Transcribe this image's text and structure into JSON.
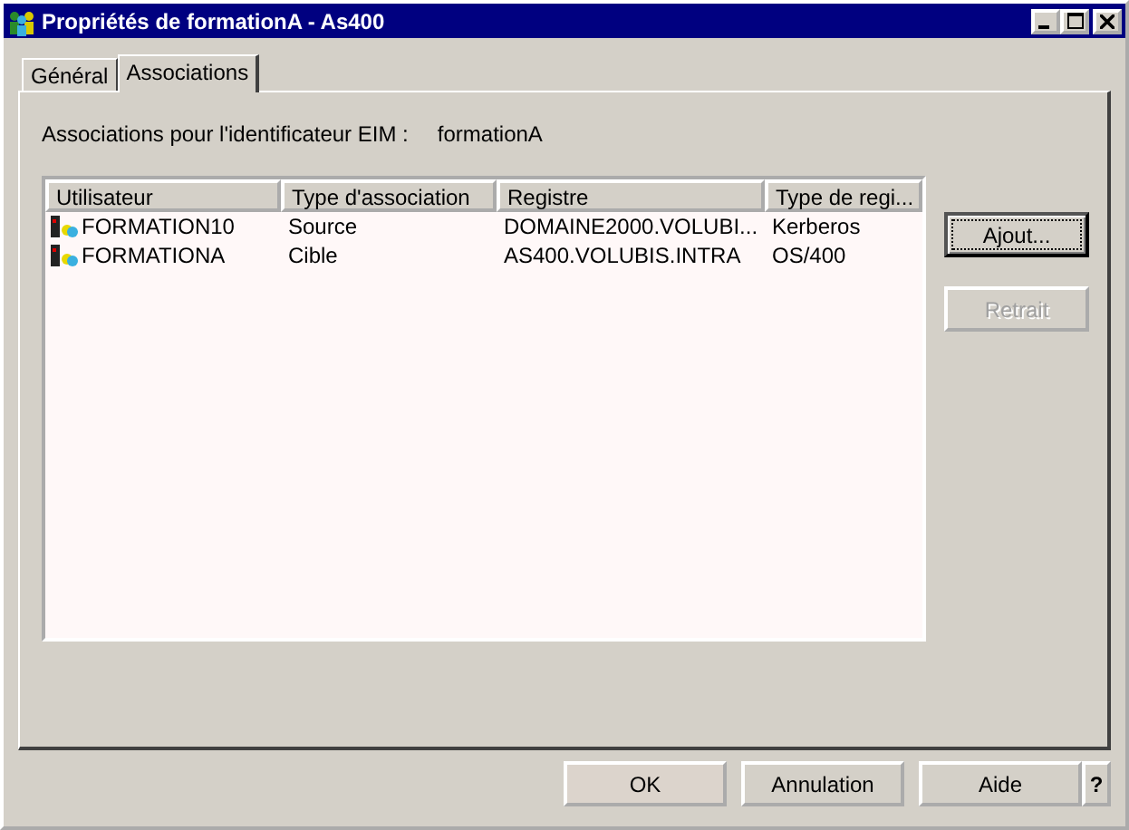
{
  "window": {
    "title": "Propriétés de formationA - As400"
  },
  "tabs": [
    {
      "label": "Général",
      "selected": false
    },
    {
      "label": "Associations",
      "selected": true
    }
  ],
  "identifier": {
    "label": "Associations pour l'identificateur EIM :",
    "value": "formationA"
  },
  "table": {
    "columns": [
      "Utilisateur",
      "Type d'association",
      "Registre",
      "Type de regi..."
    ],
    "rows": [
      {
        "cells": [
          "FORMATION10",
          "Source",
          "DOMAINE2000.VOLUBI...",
          "Kerberos"
        ],
        "selected": false
      },
      {
        "cells": [
          "FORMATIONA",
          "Cible",
          "AS400.VOLUBIS.INTRA",
          "OS/400"
        ],
        "selected": false
      }
    ]
  },
  "side_buttons": [
    {
      "label": "Ajout...",
      "disabled": false,
      "focused": true
    },
    {
      "label": "Retrait",
      "disabled": true,
      "focused": false
    }
  ],
  "footer_buttons": [
    {
      "label": "OK",
      "kind": "default"
    },
    {
      "label": "Annulation",
      "kind": "normal"
    },
    {
      "label": "Aide",
      "kind": "normal"
    },
    {
      "label": "?",
      "kind": "help"
    }
  ]
}
